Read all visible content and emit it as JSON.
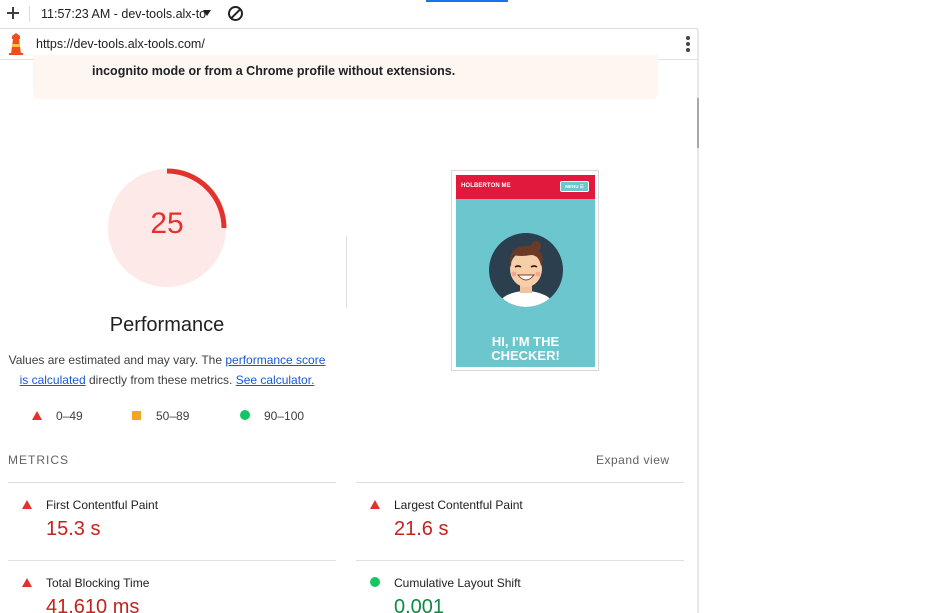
{
  "browser": {
    "tab_title": "11:57:23 AM - dev-tools.alx-to",
    "url": "https://dev-tools.alx-tools.com/"
  },
  "warning": {
    "text": "incognito mode or from a Chrome profile without extensions."
  },
  "performance": {
    "score": 25,
    "score_text": "25",
    "score_fraction": 0.25,
    "title": "Performance",
    "desc_part1": "Values are estimated and may vary. The ",
    "link_perf_score": "performance score is calculated",
    "desc_part2": " directly from these metrics. ",
    "link_calculator": "See calculator.",
    "colors": {
      "fail": "#e4312c",
      "average": "#f4a623",
      "pass": "#13c664",
      "fail_bg": "#fde9e8"
    }
  },
  "legend": [
    {
      "icon": "triangle-icon",
      "label": "0–49"
    },
    {
      "icon": "square-icon",
      "label": "50–89"
    },
    {
      "icon": "circle-icon",
      "label": "90–100"
    }
  ],
  "screenshot": {
    "brand": "HOLBERTON ME",
    "menu": "MENU ☰",
    "hero_line1": "HI, I'M THE",
    "hero_line2": "CHECKER!"
  },
  "metrics": {
    "heading": "METRICS",
    "expand": "Expand view",
    "items": [
      {
        "name": "First Contentful Paint",
        "value": "15.3 s",
        "status": "fail"
      },
      {
        "name": "Largest Contentful Paint",
        "value": "21.6 s",
        "status": "fail"
      },
      {
        "name": "Total Blocking Time",
        "value": "41,610 ms",
        "status": "fail"
      },
      {
        "name": "Cumulative Layout Shift",
        "value": "0.001",
        "status": "pass"
      }
    ]
  }
}
